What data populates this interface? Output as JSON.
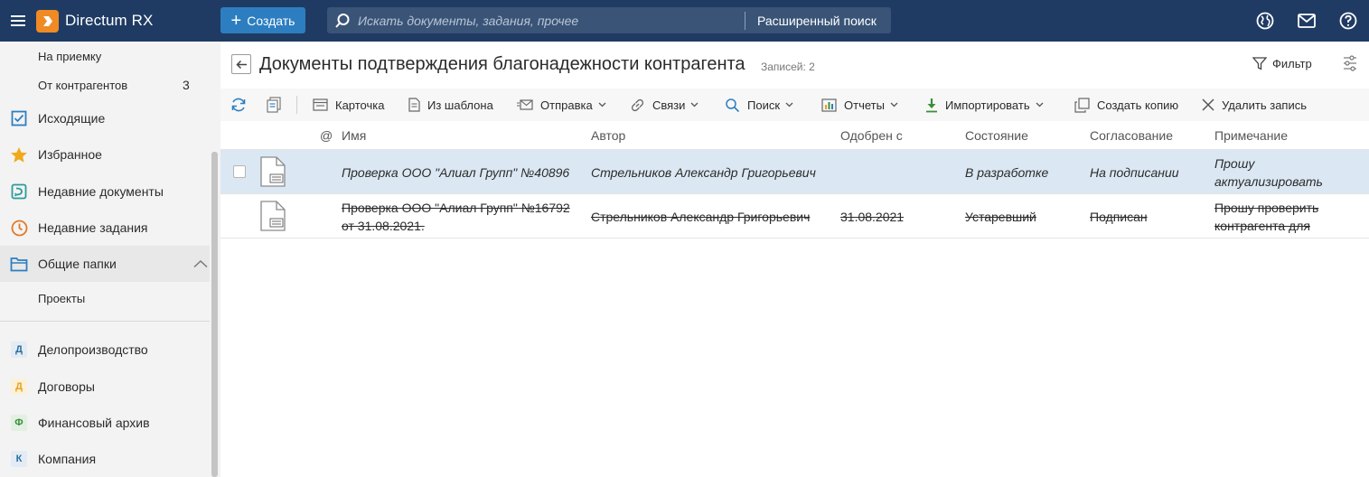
{
  "app": {
    "name": "Directum RX"
  },
  "topbar": {
    "create_label": "Создать",
    "search_placeholder": "Искать документы, задания, прочее",
    "advanced_search_label": "Расширенный поиск"
  },
  "sidebar": {
    "sub_items_top": [
      {
        "label": "На приемку"
      },
      {
        "label": "От контрагентов",
        "count": "3"
      }
    ],
    "items": [
      {
        "label": "Исходящие",
        "icon": "outgoing-check-icon"
      },
      {
        "label": "Избранное",
        "icon": "star-icon"
      },
      {
        "label": "Недавние документы",
        "icon": "recent-documents-icon"
      },
      {
        "label": "Недавние задания",
        "icon": "clock-icon"
      },
      {
        "label": "Общие папки",
        "icon": "folder-icon"
      }
    ],
    "folder_children": [
      {
        "label": "Проекты"
      }
    ],
    "modules": [
      {
        "letter": "Д",
        "label": "Делопроизводство",
        "color": "#2d6e9e",
        "bg": "#e3ecf4"
      },
      {
        "letter": "Д",
        "label": "Договоры",
        "color": "#e8a21c",
        "bg": "#fbf0d9"
      },
      {
        "letter": "Ф",
        "label": "Финансовый архив",
        "color": "#3a8f3a",
        "bg": "#e2f0e2"
      },
      {
        "letter": "К",
        "label": "Компания",
        "color": "#2d6e9e",
        "bg": "#e3ecf4"
      }
    ]
  },
  "main": {
    "title": "Документы подтверждения благонадежности контрагента",
    "records_label": "Записей: 2",
    "filter_label": "Фильтр",
    "toolbar": {
      "card": "Карточка",
      "from_template": "Из шаблона",
      "send": "Отправка",
      "relations": "Связи",
      "search": "Поиск",
      "reports": "Отчеты",
      "import": "Импортировать",
      "create_copy": "Создать копию",
      "delete_record": "Удалить запись"
    },
    "columns": {
      "at": "@",
      "name": "Имя",
      "author": "Автор",
      "approved_from": "Одобрен с",
      "state": "Состояние",
      "approval": "Согласование",
      "note": "Примечание"
    },
    "rows": [
      {
        "name": "Проверка ООО \"Алиал Групп\" №40896",
        "name_line2": "",
        "author": "Стрельников Александр Григорьевич",
        "approved_from": "",
        "state": "В разработке",
        "approval": "На подписании",
        "note": "Прошу",
        "note_line2": "актуализировать"
      },
      {
        "name": "Проверка ООО \"Алиал Групп\" №16792",
        "name_line2": "от 31.08.2021.",
        "author": "Стрельников Александр Григорьевич",
        "approved_from": "31.08.2021",
        "state": "Устаревший",
        "approval": "Подписан",
        "note": "Прошу проверить",
        "note_line2": "контрагента для"
      }
    ]
  },
  "colors": {
    "topbar": "#1f3b63",
    "accent": "#2d7ec0",
    "logo": "#f08a24",
    "selected_row": "#dbe8f3"
  }
}
